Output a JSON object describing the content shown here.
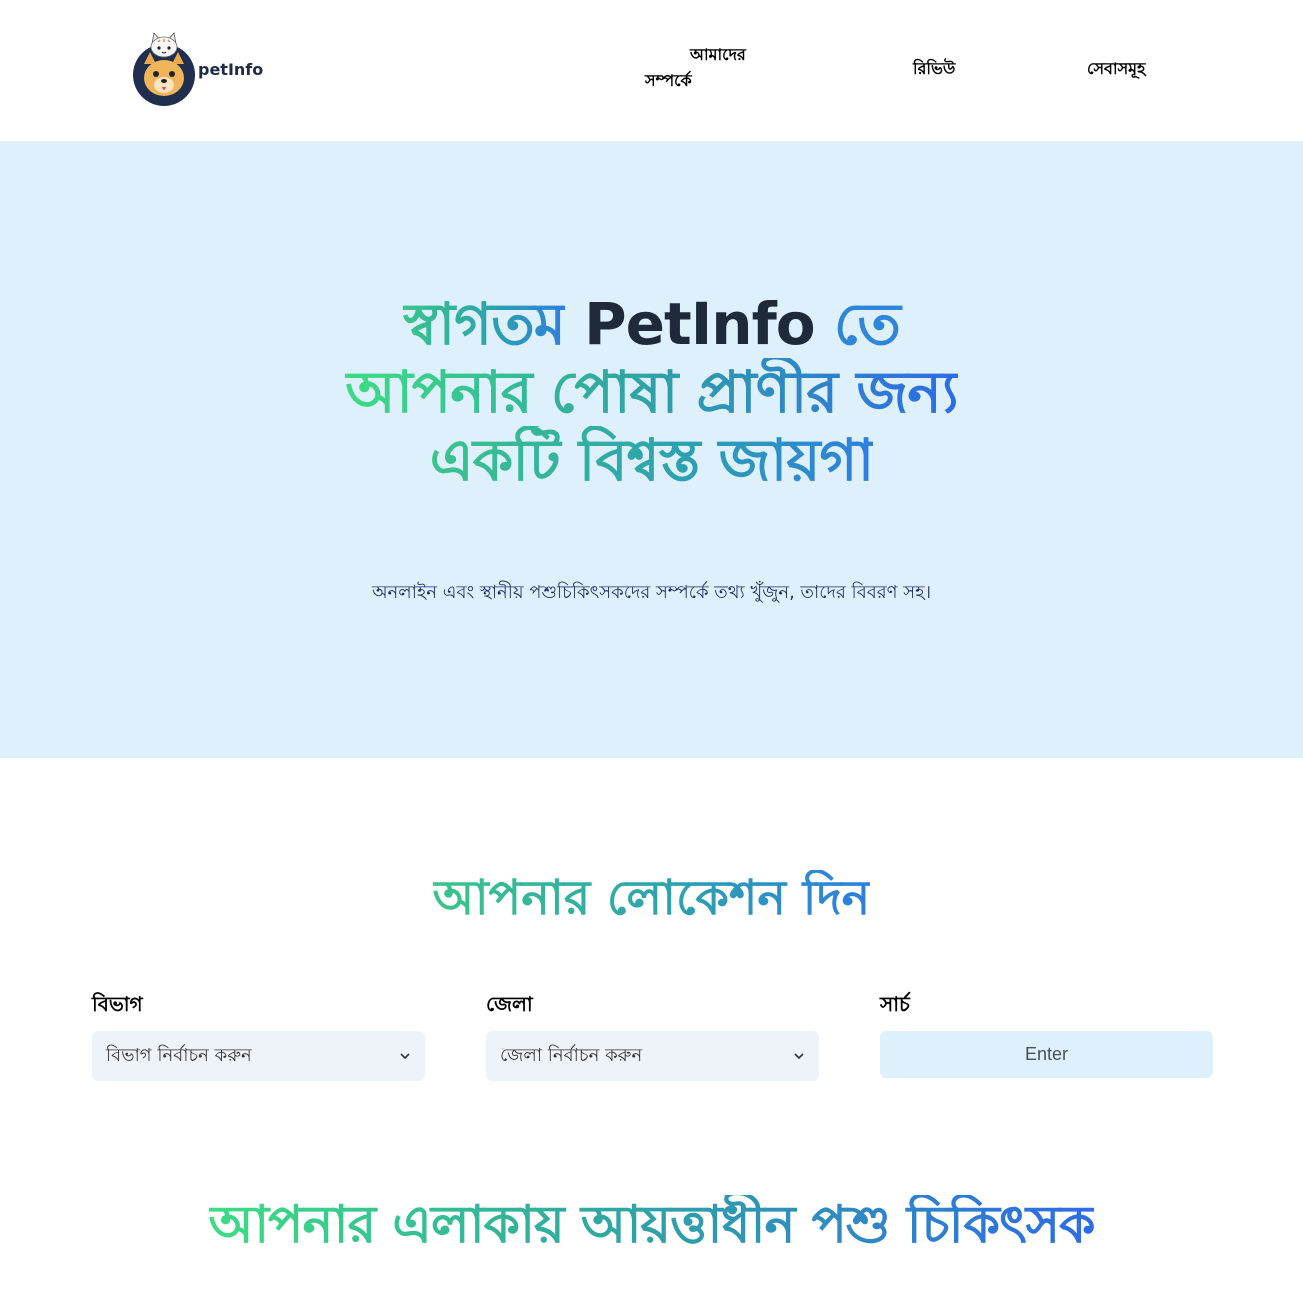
{
  "header": {
    "brand": "petInfo",
    "nav": {
      "about_line1": "আমাদের",
      "about_line2": "সম্পর্কে",
      "review": "রিভিউ",
      "services": "সেবাসমূহ"
    }
  },
  "hero": {
    "title_part1": "স্বাগতম",
    "title_brand": "PetInfo",
    "title_part2": "তে",
    "title_line2": "আপনার পোষা প্রাণীর জন্য",
    "title_line3": "একটি বিশ্বস্ত জায়গা",
    "subtitle": "অনলাইন এবং স্থানীয় পশুচিকিৎসকদের সম্পর্কে তথ্য খুঁজুন, তাদের বিবরণ সহ।"
  },
  "location": {
    "title": "আপনার লোকেশন দিন",
    "division_label": "বিভাগ",
    "division_value": "বিভাগ নির্বাচন করুন",
    "district_label": "জেলা",
    "district_value": "জেলা নির্বাচন করুন",
    "search_label": "সার্চ",
    "search_button": "Enter"
  },
  "vets": {
    "title": "আপনার এলাকায় আয়ত্তাধীন পশু চিকিৎসক"
  },
  "colors": {
    "hero_bg": "#dff0fd",
    "gradient_start": "#3ddc84",
    "gradient_end": "#2d6be8",
    "brand_dark": "#1e2a3a"
  }
}
